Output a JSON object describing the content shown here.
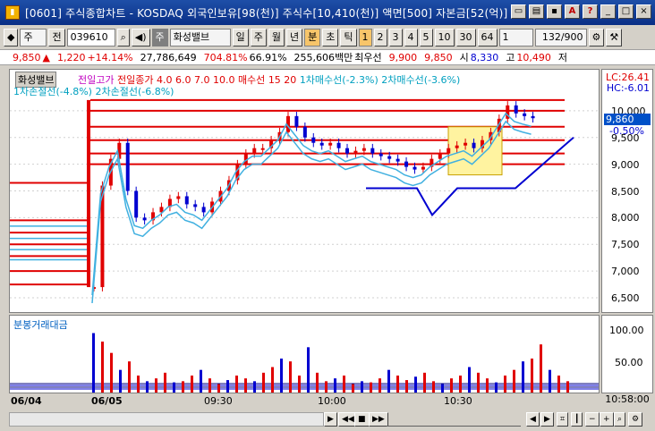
{
  "window": {
    "icon": "app-icon",
    "title": "[0601] 주식종합차트 - KOSDAQ 외국인보유[98(천)] 주식수[10,410(천)] 액면[500] 자본금[52(억)]",
    "buttons": [
      "□",
      "⊡",
      "⊠",
      "A",
      "?",
      "_",
      "□",
      "×"
    ]
  },
  "toolbar": {
    "type_select": "주",
    "before_label": "전",
    "code": "039610",
    "stock_badge": "주",
    "stock_name": "화성밸브",
    "periods": [
      "일",
      "주",
      "월",
      "년",
      "분",
      "초",
      "틱"
    ],
    "active_period": "분",
    "minutes": [
      "1",
      "2",
      "3",
      "4",
      "5",
      "10",
      "30",
      "64"
    ],
    "active_minute": "1",
    "count_value": "1",
    "page_display": "132/900"
  },
  "info": {
    "price": "9,850",
    "arrow": "▲",
    "change": "1,220",
    "change_pct": "+14.14%",
    "volume": "27,786,649",
    "vol_ratio": "704.81%",
    "rate": "66.91%",
    "amount": "255,606백만",
    "best_label": "최우선",
    "ask": "9,900",
    "bid": "9,850",
    "open_label": "시",
    "open": "8,330",
    "high_label": "고",
    "high": "10,490",
    "low_label": "저"
  },
  "legend": {
    "tag": "화성밸브",
    "prev_high": "전일고가",
    "prev_close": "전일종가",
    "mids": "4.0  6.0  7.0",
    "ten": "10.0  매수선",
    "nums": "15  20",
    "line1": "1차매수선(-2.3%)",
    "line2": "2차매수선(-3.6%)",
    "line3": "1차손절선(-4.8%)",
    "line4": "2차손절선(-6.8%)",
    "lc": "LC:26.41",
    "hc": "HC:-6.01"
  },
  "yaxis": {
    "price_ticks": [
      "10,000",
      "9,500",
      "9,000",
      "8,500",
      "8,000",
      "7,500",
      "7,000",
      "6,500"
    ],
    "current": "9,860",
    "current_pct": "-0.50%",
    "vol_ticks": [
      "100.00",
      "50.00"
    ],
    "vol_label": "분봉거래대금"
  },
  "xaxis": {
    "dates": [
      "06/04",
      "06/05"
    ],
    "times": [
      "09:30",
      "10:00",
      "10:30"
    ],
    "right_time": "10:58:00"
  },
  "chart_data": {
    "type": "candlestick",
    "title": "화성밸브",
    "ylim": [
      6400,
      10600
    ],
    "levels_red": [
      10200,
      10000,
      9700,
      9450,
      9200,
      9000,
      8650,
      7950,
      7720,
      7500,
      7280,
      7000,
      6750
    ],
    "levels_cyan": [
      9850,
      9620,
      9410,
      9220
    ],
    "series": [
      {
        "name": "price",
        "values": [
          6700,
          8600,
          9100,
          9400,
          8500,
          8000,
          7950,
          8100,
          8200,
          8350,
          8400,
          8250,
          8200,
          8100,
          8300,
          8500,
          8700,
          9000,
          9200,
          9300,
          9300,
          9450,
          9600,
          9900,
          9700,
          9500,
          9400,
          9350,
          9400,
          9300,
          9200,
          9250,
          9300,
          9200,
          9150,
          9100,
          9050,
          8950,
          8900,
          8950,
          9100,
          9200,
          9300,
          9350,
          9400,
          9300,
          9450,
          9600,
          9850,
          10100,
          9950,
          9900,
          9860
        ]
      }
    ],
    "volume": {
      "ylim": [
        0,
        120
      ],
      "values": [
        105,
        90,
        70,
        40,
        55,
        30,
        20,
        25,
        35,
        18,
        20,
        30,
        40,
        25,
        15,
        22,
        30,
        25,
        20,
        35,
        45,
        60,
        55,
        30,
        80,
        35,
        20,
        25,
        30,
        15,
        20,
        18,
        25,
        40,
        30,
        22,
        28,
        35,
        20,
        15,
        25,
        30,
        45,
        35,
        25,
        18,
        30,
        40,
        55,
        60,
        85,
        40,
        30,
        20
      ]
    }
  }
}
